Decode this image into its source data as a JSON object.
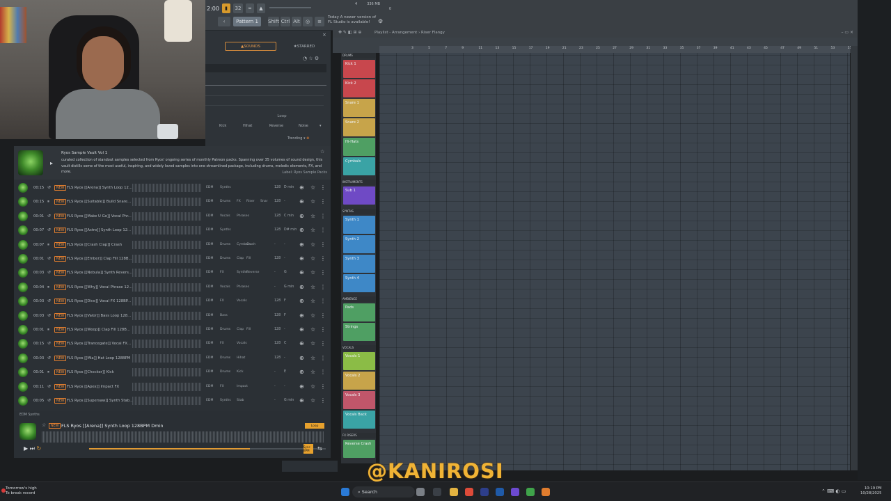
{
  "toolbar": {
    "time": "2:00",
    "bpm_mode": "32",
    "pattern": "Pattern 1",
    "buttons": [
      "Shift",
      "Ctrl",
      "Alt"
    ],
    "cpu": "4",
    "ram": "336 MB",
    "ram2": "0",
    "hint_line1": "Today  A newer version of",
    "hint_line2": "FL Studio is available!"
  },
  "browser": {
    "tabs": {
      "sounds": "SOUNDS",
      "starred": "STARRED"
    },
    "loop_label": "Loop",
    "chips": [
      "Kick",
      "Hihat",
      "Reverse",
      "Noise"
    ],
    "trending": "Trending"
  },
  "pack": {
    "title": "Ryos Sample Vault Vol 1",
    "description": "curated collection of standout samples selected from Ryos' ongoing series of monthly Patreon packs. Spanning over 35 volumes of sound design, this vault distills some of the most useful, inspiring, and widely loved samples into one streamlined package, including drums, melodic elements, FX, and more.",
    "label": "Label: Ryos Sample Packs"
  },
  "new_badge": "NEW",
  "samples": [
    {
      "time": "00:15",
      "name": "FLS Ryos [[Arena]] Synth Loop 12...",
      "tags": [
        "EDM",
        "Synths"
      ],
      "bpm": "128",
      "key": "D min"
    },
    {
      "time": "00:15",
      "name": "FLS Ryos [[Suitable]] Build Snare...",
      "tags": [
        "EDM",
        "Drums",
        "FX",
        "Riser",
        "Snar"
      ],
      "bpm": "128",
      "key": "-"
    },
    {
      "time": "00:01",
      "name": "FLS Ryos [[Make U Go]] Vocal Phr...",
      "tags": [
        "EDM",
        "Vocals",
        "Phrases"
      ],
      "bpm": "128",
      "key": "C min"
    },
    {
      "time": "00:07",
      "name": "FLS Ryos [[Astro]] Synth Loop 12...",
      "tags": [
        "EDM",
        "Synths"
      ],
      "bpm": "128",
      "key": "D# min"
    },
    {
      "time": "00:07",
      "name": "FLS Ryos [[Crash Clap]] Crash",
      "tags": [
        "EDM",
        "Drums",
        "Cymbals",
        "Crash"
      ],
      "bpm": "-",
      "key": "-"
    },
    {
      "time": "00:01",
      "name": "FLS Ryos [[Ember]] Clap Fill 128B...",
      "tags": [
        "EDM",
        "Drums",
        "Clap",
        "Fill"
      ],
      "bpm": "128",
      "key": "-"
    },
    {
      "time": "00:03",
      "name": "FLS Ryos [[Nebula]] Synth Revers...",
      "tags": [
        "EDM",
        "FX",
        "Synths",
        "Reverse"
      ],
      "bpm": "-",
      "key": "G"
    },
    {
      "time": "00:04",
      "name": "FLS Ryos [[Why]] Vocal Phrase 12...",
      "tags": [
        "EDM",
        "Vocals",
        "Phrases"
      ],
      "bpm": "-",
      "key": "G min"
    },
    {
      "time": "00:03",
      "name": "FLS Ryos [[Dice]] Vocal FX 128BP...",
      "tags": [
        "EDM",
        "FX",
        "Vocals"
      ],
      "bpm": "128",
      "key": "F"
    },
    {
      "time": "00:03",
      "name": "FLS Ryos [[Valor]] Bass Loop 128...",
      "tags": [
        "EDM",
        "Bass"
      ],
      "bpm": "128",
      "key": "F"
    },
    {
      "time": "00:01",
      "name": "FLS Ryos [[Woop]] Clap Fill 128B...",
      "tags": [
        "EDM",
        "Drums",
        "Clap",
        "Fill"
      ],
      "bpm": "128",
      "key": "-"
    },
    {
      "time": "00:15",
      "name": "FLS Ryos [[Trancegate]] Vocal FX...",
      "tags": [
        "EDM",
        "FX",
        "Vocals"
      ],
      "bpm": "128",
      "key": "C"
    },
    {
      "time": "00:03",
      "name": "FLS Ryos [[Mia]] Hat Loop 128BPM",
      "tags": [
        "EDM",
        "Drums",
        "Hihat"
      ],
      "bpm": "128",
      "key": "-"
    },
    {
      "time": "00:01",
      "name": "FLS Ryos [[Checker]] Kick",
      "tags": [
        "EDM",
        "Drums",
        "Kick"
      ],
      "bpm": "-",
      "key": "E"
    },
    {
      "time": "00:11",
      "name": "FLS Ryos [[Apex]] Impact FX",
      "tags": [
        "EDM",
        "FX",
        "Impact"
      ],
      "bpm": "-",
      "key": "-"
    },
    {
      "time": "00:05",
      "name": "FLS Ryos [[Supersaw]] Synth Stab...",
      "tags": [
        "EDM",
        "Synths",
        "Stab"
      ],
      "bpm": "-",
      "key": "G min"
    }
  ],
  "player": {
    "tags": "EDM      Synths",
    "name": "FLS Ryos [[Arena]] Synth Loop 128BPM Dmin",
    "loop": "Loop",
    "sync": "Sync BPM",
    "progress": 0.68
  },
  "playlist": {
    "title": "Playlist - Arrangement › Riser Flangy",
    "ruler": [
      "3",
      "5",
      "7",
      "9",
      "11",
      "13",
      "15",
      "17",
      "19",
      "21",
      "23",
      "25",
      "27",
      "29",
      "31",
      "33",
      "35",
      "37",
      "39",
      "41",
      "43",
      "45",
      "47",
      "49",
      "51",
      "53",
      "55"
    ]
  },
  "rack": {
    "sections": [
      {
        "label": "DRUMS",
        "channels": [
          {
            "name": "Kick 1",
            "color": "#c8474d"
          },
          {
            "name": "Kick 2",
            "color": "#c8474d"
          },
          {
            "name": "Snare 1",
            "color": "#c7a44a"
          },
          {
            "name": "Snare 2",
            "color": "#c7a44a"
          },
          {
            "name": "Hi-Hats",
            "color": "#4f9f63"
          },
          {
            "name": "Cymbals",
            "color": "#3aa3a5"
          }
        ]
      },
      {
        "label": "INSTRUMENTS",
        "channels": [
          {
            "name": "Sub 1",
            "color": "#6f4ac5"
          }
        ]
      },
      {
        "label": "SYNTHS",
        "channels": [
          {
            "name": "Synth 1",
            "color": "#3e88c7"
          },
          {
            "name": "Synth 2",
            "color": "#3e88c7"
          },
          {
            "name": "Synth 3",
            "color": "#3e88c7"
          },
          {
            "name": "Synth 4",
            "color": "#3e88c7"
          }
        ]
      },
      {
        "label": "AMBIENCE",
        "channels": [
          {
            "name": "Pads",
            "color": "#4f9f63"
          },
          {
            "name": "Strings",
            "color": "#4f9f63"
          }
        ]
      },
      {
        "label": "VOCALS",
        "channels": [
          {
            "name": "Vocals 1",
            "color": "#8bbc46"
          },
          {
            "name": "Vocals 2",
            "color": "#c7a44a"
          },
          {
            "name": "Vocals 3",
            "color": "#c0566a"
          },
          {
            "name": "Vocals Back",
            "color": "#3aa3a5"
          }
        ]
      },
      {
        "label": "FX RISERS",
        "channels": [
          {
            "name": "Reverse Crash",
            "color": "#4f9f63"
          }
        ]
      }
    ]
  },
  "watermark": "@KANIROSI",
  "taskbar": {
    "weather_line1": "Tomorrow's high",
    "weather_line2": "To break record",
    "search": "Search",
    "time": "10:19 PM",
    "date": "10/28/2025"
  }
}
